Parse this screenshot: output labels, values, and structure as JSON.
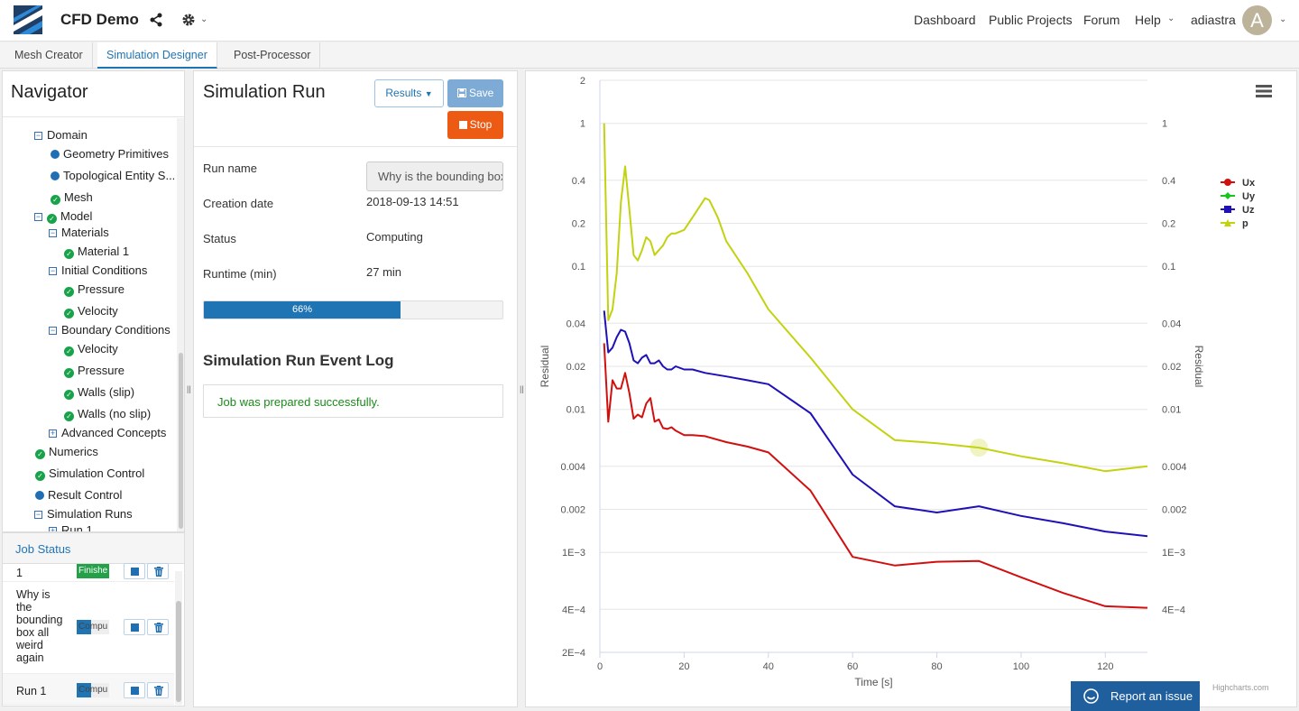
{
  "header": {
    "app_title": "CFD Demo",
    "nav_links": [
      "Dashboard",
      "Public Projects",
      "Forum",
      "Help"
    ],
    "username": "adiastra",
    "avatar_letter": "A"
  },
  "tabs": [
    {
      "label": "Mesh Creator",
      "active": false
    },
    {
      "label": "Simulation Designer",
      "active": true
    },
    {
      "label": "Post-Processor",
      "active": false
    }
  ],
  "navigator": {
    "title": "Navigator",
    "items": [
      {
        "label": "Domain",
        "icon": "collapse",
        "level": 1
      },
      {
        "label": "Geometry Primitives",
        "icon": "dot",
        "level": 2
      },
      {
        "label": "Topological Entity S...",
        "icon": "dot",
        "level": 2
      },
      {
        "label": "Mesh",
        "icon": "check",
        "level": 2
      },
      {
        "label": "Model",
        "icon": "collapse-check",
        "level": 1
      },
      {
        "label": "Materials",
        "icon": "collapse",
        "level": 2
      },
      {
        "label": "Material 1",
        "icon": "check",
        "level": 3
      },
      {
        "label": "Initial Conditions",
        "icon": "collapse",
        "level": 2
      },
      {
        "label": "Pressure",
        "icon": "check",
        "level": 3
      },
      {
        "label": "Velocity",
        "icon": "check",
        "level": 3
      },
      {
        "label": "Boundary Conditions",
        "icon": "collapse",
        "level": 2
      },
      {
        "label": "Velocity",
        "icon": "check",
        "level": 3
      },
      {
        "label": "Pressure",
        "icon": "check",
        "level": 3
      },
      {
        "label": "Walls (slip)",
        "icon": "check",
        "level": 3
      },
      {
        "label": "Walls (no slip)",
        "icon": "check",
        "level": 3
      },
      {
        "label": "Advanced Concepts",
        "icon": "expand",
        "level": 2
      },
      {
        "label": "Numerics",
        "icon": "check",
        "level": 0
      },
      {
        "label": "Simulation Control",
        "icon": "check",
        "level": 0
      },
      {
        "label": "Result Control",
        "icon": "dot",
        "level": 0
      },
      {
        "label": "Simulation Runs",
        "icon": "collapse",
        "level": 1
      },
      {
        "label": "Run 1",
        "icon": "expand",
        "level": 2
      }
    ]
  },
  "job_status": {
    "title": "Job Status",
    "rows": [
      {
        "name": "1",
        "status": "Finishe",
        "progress": 1.0
      },
      {
        "name": "Why is the bounding box all weird again",
        "status": "Compu",
        "progress": 0.45
      },
      {
        "name": "Run 1",
        "status": "Compu",
        "progress": 0.45
      }
    ]
  },
  "simulation": {
    "title": "Simulation Run",
    "results_label": "Results",
    "save_label": "Save",
    "stop_label": "Stop",
    "fields": {
      "run_name_label": "Run name",
      "run_name_value": "Why is the bounding box all weird again",
      "creation_date_label": "Creation date",
      "creation_date_value": "2018-09-13 14:51",
      "status_label": "Status",
      "status_value": "Computing",
      "runtime_label": "Runtime (min)",
      "runtime_value": "27 min"
    },
    "progress": 0.66,
    "progress_text": "66%",
    "log_title": "Simulation Run Event Log",
    "log_messages": [
      "Job was prepared successfully."
    ]
  },
  "chart_data": {
    "type": "line",
    "xlabel": "Time [s]",
    "ylabel": "Residual",
    "y2label": "Residual",
    "yscale": "log",
    "xlim": [
      0,
      130
    ],
    "ylim": [
      0.0002,
      2
    ],
    "x_ticks": [
      0,
      20,
      40,
      60,
      80,
      100,
      120
    ],
    "y_ticks": [
      2,
      1,
      0.4,
      0.2,
      0.1,
      0.04,
      0.02,
      0.01,
      0.004,
      0.002,
      0.001,
      0.0004,
      0.0002
    ],
    "y_tick_labels": [
      "2",
      "1",
      "0.4",
      "0.2",
      "0.1",
      "0.04",
      "0.02",
      "0.01",
      "0.004",
      "0.002",
      "1E−3",
      "4E−4",
      "2E−4"
    ],
    "y2_ticks": [
      1,
      0.4,
      0.2,
      0.1,
      0.04,
      0.02,
      0.01,
      0.004,
      0.002,
      0.001,
      0.0004
    ],
    "y2_tick_labels": [
      "1",
      "0.4",
      "0.2",
      "0.1",
      "0.04",
      "0.02",
      "0.01",
      "0.004",
      "0.002",
      "1E−3",
      "4E−4"
    ],
    "legend_position": "right",
    "credits": "Highcharts.com",
    "series": [
      {
        "name": "Ux",
        "color": "#d20f0f",
        "marker": "circle",
        "x": [
          1,
          2,
          3,
          4,
          5,
          6,
          7,
          8,
          9,
          10,
          11,
          12,
          13,
          14,
          15,
          16,
          17,
          18,
          20,
          22,
          25,
          30,
          35,
          40,
          50,
          60,
          70,
          80,
          90,
          100,
          110,
          120,
          130
        ],
        "y": [
          0.029,
          0.0082,
          0.016,
          0.014,
          0.014,
          0.018,
          0.013,
          0.0086,
          0.0092,
          0.0088,
          0.011,
          0.012,
          0.0082,
          0.0085,
          0.0074,
          0.0073,
          0.0075,
          0.0071,
          0.0066,
          0.0066,
          0.0065,
          0.0059,
          0.0055,
          0.005,
          0.0027,
          0.00093,
          0.00081,
          0.00086,
          0.00087,
          0.00067,
          0.00052,
          0.00042,
          0.00041
        ]
      },
      {
        "name": "Uy",
        "color": "#18c61a",
        "marker": "diamond",
        "x": [],
        "y": []
      },
      {
        "name": "Uz",
        "color": "#1f10b8",
        "marker": "square",
        "x": [
          1,
          2,
          3,
          4,
          5,
          6,
          7,
          8,
          9,
          10,
          11,
          12,
          13,
          14,
          15,
          16,
          17,
          18,
          20,
          22,
          25,
          30,
          35,
          40,
          50,
          60,
          70,
          80,
          90,
          100,
          110,
          120,
          130
        ],
        "y": [
          0.049,
          0.025,
          0.027,
          0.032,
          0.036,
          0.035,
          0.029,
          0.022,
          0.021,
          0.023,
          0.024,
          0.021,
          0.021,
          0.022,
          0.02,
          0.019,
          0.019,
          0.02,
          0.019,
          0.019,
          0.018,
          0.017,
          0.016,
          0.015,
          0.0094,
          0.0035,
          0.0021,
          0.0019,
          0.0021,
          0.0018,
          0.0016,
          0.0014,
          0.0013
        ]
      },
      {
        "name": "p",
        "color": "#c3d20f",
        "marker": "triangle",
        "x": [
          1,
          2,
          3,
          4,
          5,
          6,
          7,
          8,
          9,
          10,
          11,
          12,
          13,
          14,
          15,
          16,
          17,
          18,
          20,
          22,
          25,
          26,
          28,
          30,
          35,
          40,
          50,
          60,
          70,
          80,
          90,
          100,
          110,
          120,
          130
        ],
        "y": [
          1.0,
          0.042,
          0.05,
          0.09,
          0.28,
          0.5,
          0.25,
          0.12,
          0.11,
          0.13,
          0.16,
          0.15,
          0.12,
          0.13,
          0.14,
          0.16,
          0.17,
          0.17,
          0.18,
          0.22,
          0.3,
          0.29,
          0.22,
          0.15,
          0.09,
          0.05,
          0.023,
          0.01,
          0.0061,
          0.0058,
          0.0054,
          0.0047,
          0.0042,
          0.0037,
          0.004
        ]
      }
    ]
  },
  "report_button": "Report an issue",
  "colors": {
    "accent": "#1f74b4",
    "stop": "#ec5a13",
    "success": "#1a8a1a",
    "save": "#7eabd6"
  }
}
